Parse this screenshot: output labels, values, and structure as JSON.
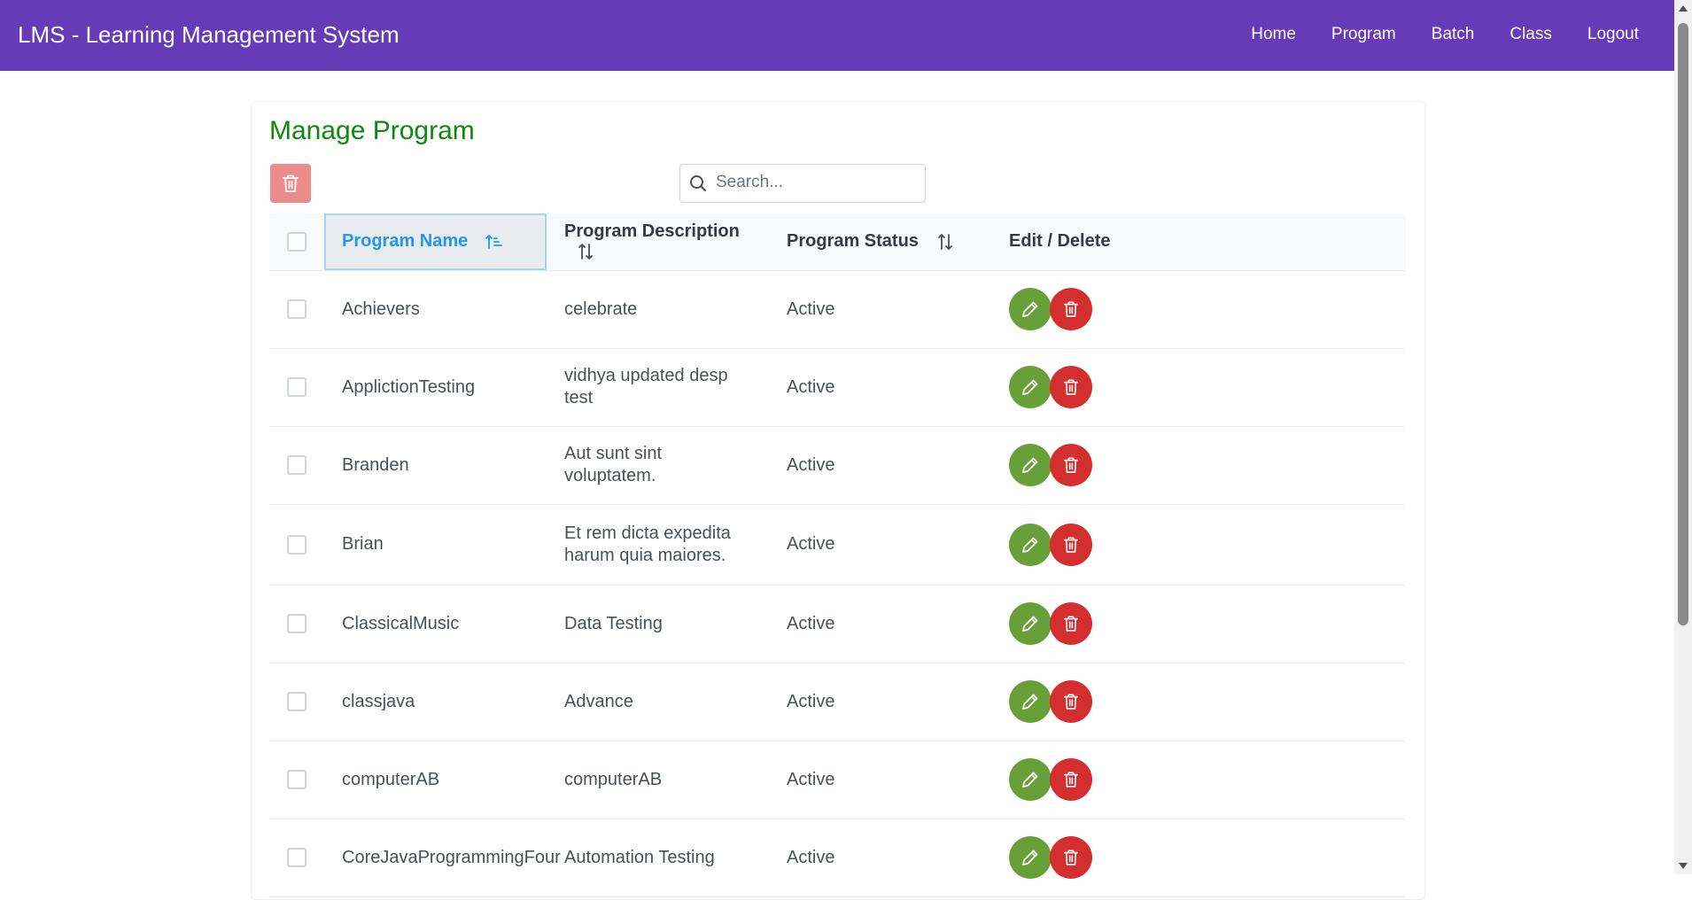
{
  "header": {
    "title": "LMS - Learning Management System",
    "nav": [
      "Home",
      "Program",
      "Batch",
      "Class",
      "Logout"
    ]
  },
  "page": {
    "title": "Manage Program",
    "search_placeholder": "Search..."
  },
  "table": {
    "columns": [
      "Program Name",
      "Program Description",
      "Program Status",
      "Edit / Delete"
    ],
    "sorted_column": "Program Name",
    "rows": [
      {
        "name": "Achievers",
        "description": "celebrate",
        "status": "Active"
      },
      {
        "name": "ApplictionTesting",
        "description": "vidhya updated desp test",
        "status": "Active"
      },
      {
        "name": "Branden",
        "description": "Aut sunt sint voluptatem.",
        "status": "Active"
      },
      {
        "name": "Brian",
        "description": "Et rem dicta expedita harum quia maiores.",
        "status": "Active"
      },
      {
        "name": "ClassicalMusic",
        "description": "Data Testing",
        "status": "Active"
      },
      {
        "name": "classjava",
        "description": "Advance",
        "status": "Active"
      },
      {
        "name": "computerAB",
        "description": "computerAB",
        "status": "Active"
      },
      {
        "name": "CoreJavaProgrammingFour",
        "description": "Automation Testing",
        "status": "Active"
      }
    ]
  },
  "colors": {
    "header_bg": "#673ab7",
    "title_green": "#0b8a0b",
    "edit_green": "#689f38",
    "delete_red": "#d32f2f",
    "bulk_delete_bg": "#ec8c8c",
    "sort_active_blue": "#2196f3"
  },
  "icons": {
    "bulk_delete": "trash-icon",
    "search": "search-icon",
    "sort_active": "sort-amount-up-icon",
    "sort": "sort-alt-icon",
    "edit": "pencil-icon",
    "delete": "trash-icon"
  }
}
